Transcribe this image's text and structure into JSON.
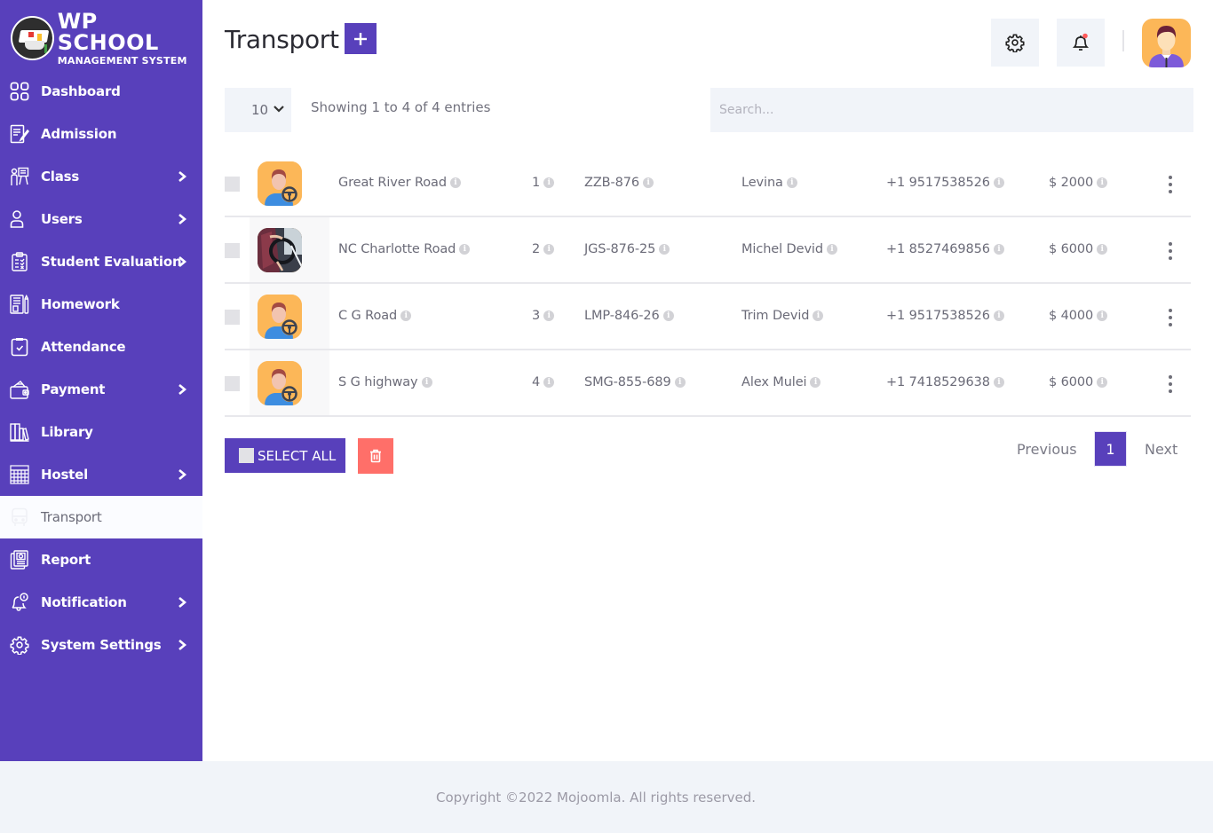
{
  "brand": {
    "title": "WP SCHOOL",
    "subtitle": "MANAGEMENT SYSTEM"
  },
  "sidebar": {
    "items": [
      {
        "label": "Dashboard",
        "icon": "dashboard-icon",
        "has_submenu": false,
        "active": false
      },
      {
        "label": "Admission",
        "icon": "admission-icon",
        "has_submenu": false,
        "active": false
      },
      {
        "label": "Class",
        "icon": "class-icon",
        "has_submenu": true,
        "active": false
      },
      {
        "label": "Users",
        "icon": "user-icon",
        "has_submenu": true,
        "active": false
      },
      {
        "label": "Student Evaluation",
        "icon": "evaluation-icon",
        "has_submenu": true,
        "active": false
      },
      {
        "label": "Homework",
        "icon": "homework-icon",
        "has_submenu": false,
        "active": false
      },
      {
        "label": "Attendance",
        "icon": "attendance-icon",
        "has_submenu": false,
        "active": false
      },
      {
        "label": "Payment",
        "icon": "wallet-icon",
        "has_submenu": true,
        "active": false
      },
      {
        "label": "Library",
        "icon": "library-icon",
        "has_submenu": false,
        "active": false
      },
      {
        "label": "Hostel",
        "icon": "hostel-icon",
        "has_submenu": true,
        "active": false
      },
      {
        "label": "Transport",
        "icon": "bus-icon",
        "has_submenu": false,
        "active": true
      },
      {
        "label": "Report",
        "icon": "report-icon",
        "has_submenu": false,
        "active": false
      },
      {
        "label": "Notification",
        "icon": "notification-icon",
        "has_submenu": true,
        "active": false
      },
      {
        "label": "System Settings",
        "icon": "gear-icon",
        "has_submenu": true,
        "active": false
      }
    ]
  },
  "header": {
    "title": "Transport",
    "add_icon": "plus-icon",
    "settings_icon": "gear-icon",
    "notification_icon": "bell-icon",
    "notification_dot_color": "#ff5b5b"
  },
  "controls": {
    "page_length": "10",
    "info": "Showing 1 to 4 of 4 entries",
    "search_placeholder": "Search...",
    "search_value": ""
  },
  "table": {
    "rows": [
      {
        "avatar": "driver-illustration",
        "route": "Great River Road",
        "number": "1",
        "vehicle": "ZZB-876",
        "driver": "Levina",
        "phone": "+1 9517538526",
        "fare": "$ 2000"
      },
      {
        "avatar": "driver-photo",
        "route": "NC Charlotte Road",
        "number": "2",
        "vehicle": "JGS-876-25",
        "driver": "Michel Devid",
        "phone": "+1 8527469856",
        "fare": "$ 6000"
      },
      {
        "avatar": "driver-illustration",
        "route": "C G Road",
        "number": "3",
        "vehicle": "LMP-846-26",
        "driver": "Trim Devid",
        "phone": "+1 9517538526",
        "fare": "$ 4000"
      },
      {
        "avatar": "driver-illustration",
        "route": "S G highway",
        "number": "4",
        "vehicle": "SMG-855-689",
        "driver": "Alex Mulei",
        "phone": "+1 7418529638",
        "fare": "$ 6000"
      }
    ]
  },
  "actions": {
    "select_all": "SELECT ALL",
    "delete_icon": "trash-icon"
  },
  "pagination": {
    "previous": "Previous",
    "current": "1",
    "next": "Next"
  },
  "footer": {
    "copyright": "Copyright ©2022 Mojoomla. All rights reserved."
  },
  "colors": {
    "primary": "#5840bb",
    "danger": "#ff6f69",
    "surface": "#f1f4f9",
    "avatar_bg": "#fcb758"
  }
}
